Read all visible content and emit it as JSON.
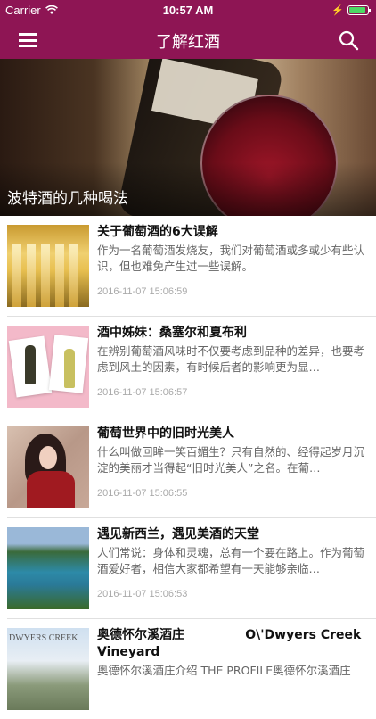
{
  "status": {
    "carrier": "Carrier",
    "time": "10:57 AM"
  },
  "nav": {
    "title": "了解红酒"
  },
  "hero": {
    "caption": "波特酒的几种喝法"
  },
  "articles": [
    {
      "title": "关于葡萄酒的6大误解",
      "desc": "作为一名葡萄酒发烧友，我们对葡萄酒或多或少有些认识，但也难免产生过一些误解。",
      "date": "2016-11-07 15:06:59"
    },
    {
      "title": "酒中姊妹：桑塞尔和夏布利",
      "desc": "在辨别葡萄酒风味时不仅要考虑到品种的差异，也要考虑到风土的因素，有时候后者的影响更为显…",
      "date": "2016-11-07 15:06:57"
    },
    {
      "title": "葡萄世界中的旧时光美人",
      "desc": "什么叫做回眸一笑百媚生？只有自然的、经得起岁月沉淀的美丽才当得起“旧时光美人”之名。在葡…",
      "date": "2016-11-07 15:06:55"
    },
    {
      "title": "遇见新西兰，遇见美酒的天堂",
      "desc": "人们常说：身体和灵魂，总有一个要在路上。作为葡萄酒爱好者，相信大家都希望有一天能够亲临…",
      "date": "2016-11-07 15:06:53"
    },
    {
      "title": "奥德怀尔溪酒庄              O\\'Dwyers Creek Vineyard",
      "desc": "奥德怀尔溪酒庄介绍 THE PROFILE奥德怀尔溪酒庄",
      "date": "",
      "thumb_logo": "DWYERS CREEK"
    }
  ]
}
